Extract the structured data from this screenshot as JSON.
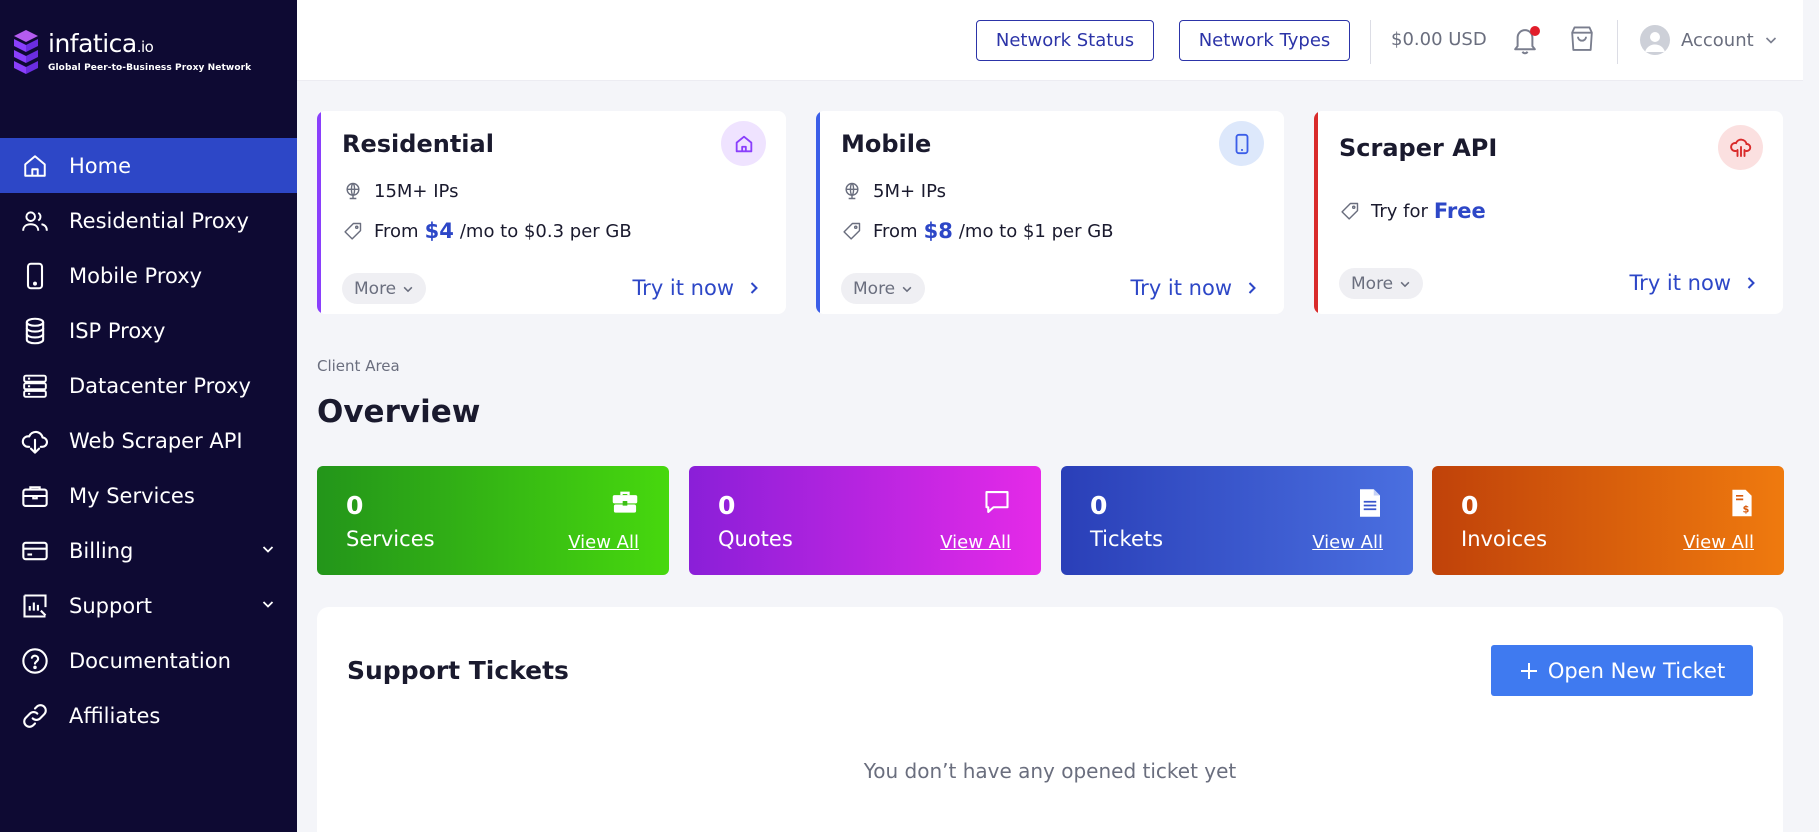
{
  "brand": {
    "name": "infatica",
    "suffix": ".io",
    "tagline": "Global Peer-to-Business Proxy Network"
  },
  "sidebar": {
    "items": [
      {
        "label": "Home",
        "icon": "home-icon",
        "active": true
      },
      {
        "label": "Residential Proxy",
        "icon": "users-icon"
      },
      {
        "label": "Mobile Proxy",
        "icon": "mobile-icon"
      },
      {
        "label": "ISP Proxy",
        "icon": "database-icon"
      },
      {
        "label": "Datacenter Proxy",
        "icon": "server-icon"
      },
      {
        "label": "Web Scraper API",
        "icon": "cloud-download-icon"
      },
      {
        "label": "My Services",
        "icon": "briefcase-icon"
      },
      {
        "label": "Billing",
        "icon": "credit-card-icon",
        "expandable": true
      },
      {
        "label": "Support",
        "icon": "chart-icon",
        "expandable": true
      },
      {
        "label": "Documentation",
        "icon": "help-circle-icon"
      },
      {
        "label": "Affiliates",
        "icon": "link-icon"
      }
    ]
  },
  "topbar": {
    "network_status": "Network Status",
    "network_types": "Network Types",
    "balance": "$0.00 USD",
    "account": "Account"
  },
  "products": [
    {
      "title": "Residential",
      "ips": "15M+ IPs",
      "price_prefix": "From",
      "price": "$4",
      "price_suffix": "/mo to $0.3 per GB",
      "more": "More",
      "cta": "Try it now",
      "accent": "#8a3ffc"
    },
    {
      "title": "Mobile",
      "ips": "5M+ IPs",
      "price_prefix": "From",
      "price": "$8",
      "price_suffix": "/mo to $1 per GB",
      "more": "More",
      "cta": "Try it now",
      "accent": "#3b5ee8"
    },
    {
      "title": "Scraper API",
      "try_prefix": "Try for",
      "try_free": "Free",
      "more": "More",
      "cta": "Try it now",
      "accent": "#d92b2b"
    }
  ],
  "overview": {
    "breadcrumb": "Client Area",
    "title": "Overview",
    "stats": [
      {
        "value": "0",
        "label": "Services",
        "link": "View All",
        "icon": "briefcase-icon"
      },
      {
        "value": "0",
        "label": "Quotes",
        "link": "View All",
        "icon": "chat-icon"
      },
      {
        "value": "0",
        "label": "Tickets",
        "link": "View All",
        "icon": "document-icon"
      },
      {
        "value": "0",
        "label": "Invoices",
        "link": "View All",
        "icon": "invoice-icon"
      }
    ]
  },
  "support": {
    "title": "Support Tickets",
    "open_button": "Open New Ticket",
    "empty": "You don’t have any opened ticket yet"
  }
}
